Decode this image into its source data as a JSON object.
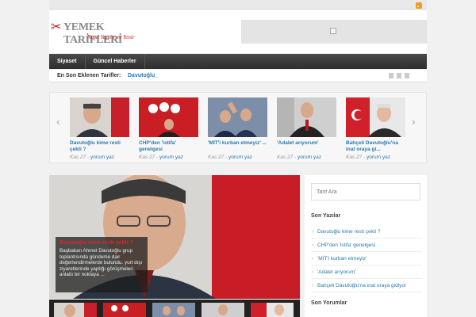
{
  "header": {
    "logo_title": "YEMEK TARİFLERİ",
    "logo_subtitle": "Nasıl Yapılır ve Yenir"
  },
  "nav": {
    "items": [
      {
        "label": "Siyaset"
      },
      {
        "label": "Güncel Haberler"
      }
    ]
  },
  "ticker": {
    "label": "En Son Eklenen Tarifler:",
    "text": "Davutoğlu_"
  },
  "slider": {
    "cards": [
      {
        "title": "Davutoğlu kime resti çekti ?",
        "date": "Kas 27",
        "comment": "yorum yaz"
      },
      {
        "title": "CHP'den 'istifa' genelgesi",
        "date": "Kas 27",
        "comment": "yorum yaz"
      },
      {
        "title": "'MİT'i kurban etmeyiz' ...",
        "date": "Kas 27",
        "comment": "yorum yaz"
      },
      {
        "title": "'Adalet arıyorum'",
        "date": "Kas 27",
        "comment": "yorum yaz"
      },
      {
        "title": "Bahçeli Davutoğlu'na inat oraya gi...",
        "date": "Kas 27",
        "comment": "yorum yaz"
      }
    ]
  },
  "feature": {
    "title": "Davutoğlu kime resti çekti ?",
    "text": "Başbakan Ahmet Davutoğlu grup toplantısında gündeme dair değerlendirmelerde bulundu. yurt dışı ziyaretlerinde yaptığı görüşmeleri anlattı bir noktaya ..."
  },
  "sidebar": {
    "search_placeholder": "Tarif Ara",
    "recent_heading": "Son Yazılar",
    "recent": [
      "Davutoğlu kime resti çekti ?",
      "CHP'den 'istifa' genelgesi",
      "'MİT'i kurban etmeyiz'",
      "'Adalet arıyorum'",
      "Bahçeli Davutoğlu'na inat oraya gidiyor"
    ],
    "comments_heading": "Son Yorumlar"
  },
  "colors": {
    "accent": "#2a7ab0",
    "brand_red": "#c01818",
    "nav_bg": "#3a3a3a"
  },
  "icons": {
    "rss": "rss-icon",
    "ad_placeholder": "image-placeholder-icon",
    "slider_prev": "chevron-left-icon",
    "slider_next": "chevron-right-icon"
  }
}
